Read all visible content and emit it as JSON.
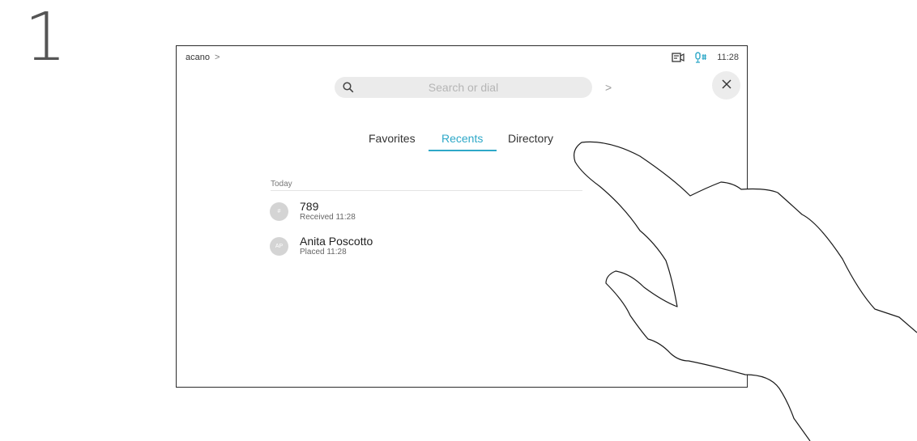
{
  "step": {
    "number": "1"
  },
  "header": {
    "system_name": "acano",
    "chevron": ">"
  },
  "status": {
    "time": "11:28",
    "camera_icon": "camera-icon",
    "mic_icon": "microphone-icon"
  },
  "search": {
    "placeholder": "Search or dial",
    "arrow": ">"
  },
  "close": {
    "icon": "close-icon"
  },
  "tabs": [
    {
      "label": "Favorites",
      "active": false
    },
    {
      "label": "Recents",
      "active": true
    },
    {
      "label": "Directory",
      "active": false
    }
  ],
  "recents": {
    "section_label": "Today",
    "items": [
      {
        "avatar": "#",
        "name": "789",
        "detail": "Received 11:28"
      },
      {
        "avatar": "AP",
        "name": "Anita Poscotto",
        "detail": "Placed 11:28"
      }
    ]
  },
  "colors": {
    "accent": "#2ea8c8",
    "avatar_bg": "#d4d4d4",
    "search_bg": "#ebebeb"
  }
}
